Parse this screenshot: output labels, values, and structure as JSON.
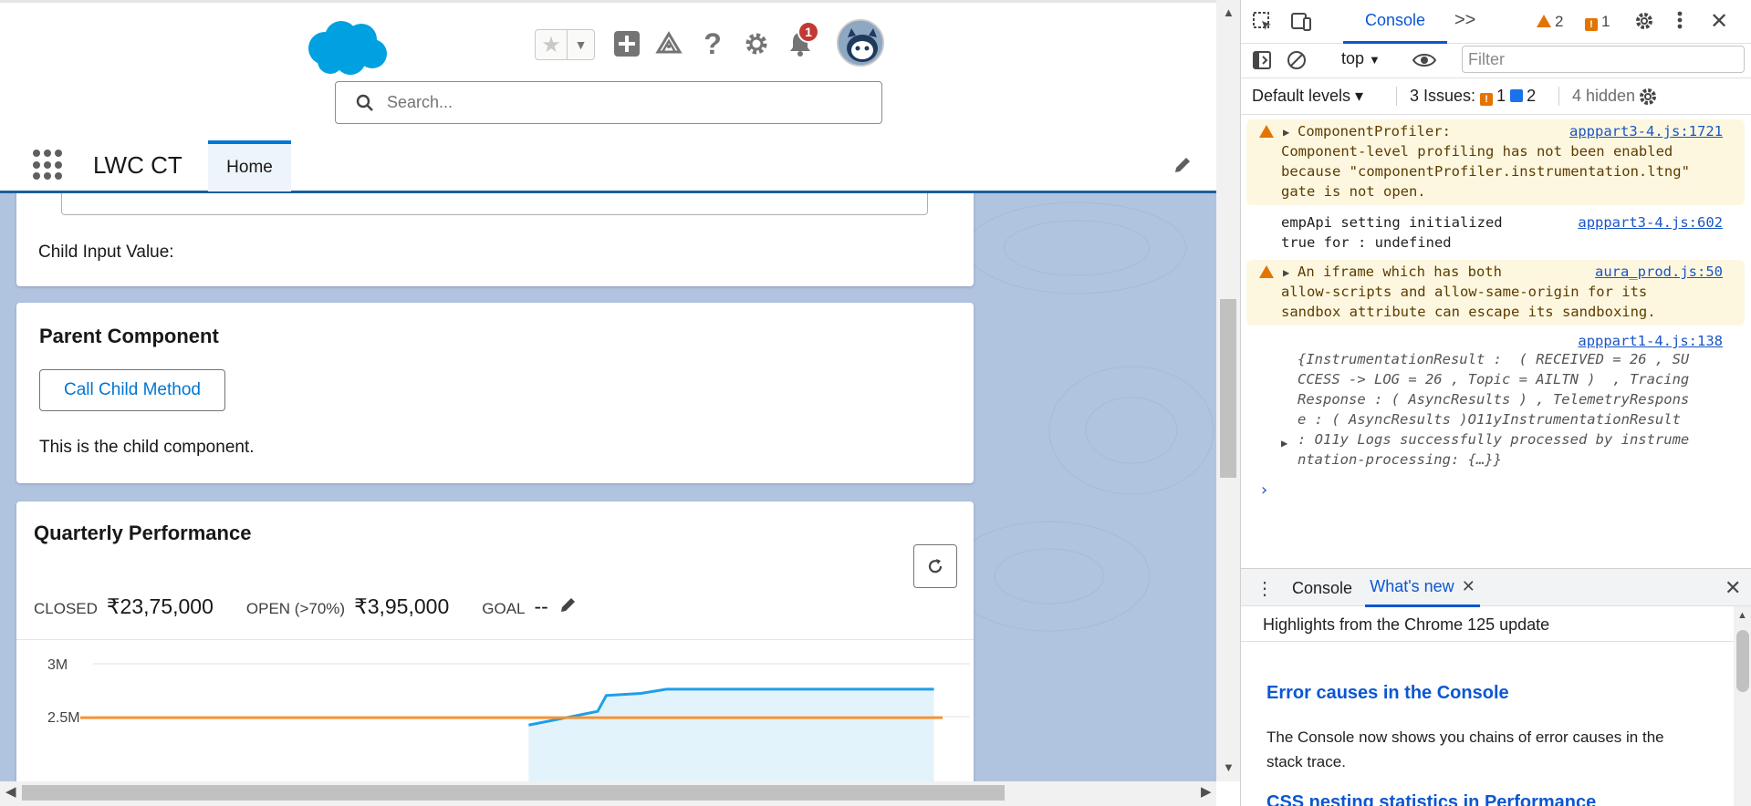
{
  "header": {
    "search_placeholder": "Search...",
    "notification_count": "1",
    "help_glyph": "?"
  },
  "nav": {
    "app_name": "LWC CT",
    "tab_home": "Home"
  },
  "card_child_input": {
    "label": "Child Input Value:"
  },
  "card_parent": {
    "title": "Parent Component",
    "button_label": "Call Child Method",
    "child_text": "This is the child component."
  },
  "card_performance": {
    "title": "Quarterly Performance",
    "closed_label": "CLOSED",
    "closed_value": "₹23,75,000",
    "open_label": "OPEN (>70%)",
    "open_value": "₹3,95,000",
    "goal_label": "GOAL",
    "goal_value": "--"
  },
  "chart_data": {
    "type": "line",
    "title": "",
    "yticks": [
      "3M",
      "2.5M"
    ],
    "ylim": [
      2.45,
      3.0
    ],
    "series": [
      {
        "color": "#1e9fe8",
        "fill": "#e3f3fb",
        "x": [
          0.52,
          0.6,
          0.61,
          0.65,
          0.68,
          0.99
        ],
        "y": [
          2.42,
          2.55,
          2.7,
          2.72,
          2.76,
          2.76
        ]
      },
      {
        "color": "#f59331",
        "x": [
          0,
          1
        ],
        "y": [
          2.49,
          2.49
        ]
      }
    ]
  },
  "devtools": {
    "tab_console": "Console",
    "more_tabs": ">>",
    "warn_count": "2",
    "error_count": "1",
    "context": "top",
    "filter_placeholder": "Filter",
    "default_levels": "Default levels ▾",
    "issues_label": "3 Issues:",
    "issues_error": "1",
    "issues_info": "2",
    "hidden": "4 hidden",
    "messages": [
      {
        "source": "apppart3-4.js:1721",
        "text": "ComponentProfiler:\nComponent-level profiling has not been enabled\nbecause \"componentProfiler.instrumentation.ltng\"\ngate is not open."
      },
      {
        "source": "apppart3-4.js:602",
        "text": "empApi setting initialized\ntrue for : undefined"
      },
      {
        "source": "aura_prod.js:50",
        "text": "An iframe which has both\nallow-scripts and allow-same-origin for its\nsandbox attribute can escape its sandboxing."
      },
      {
        "source": "apppart1-4.js:138",
        "text": "{InstrumentationResult :  ( RECEIVED = 26 , SU\nCCESS -> LOG = 26 , Topic = AILTN )  , Tracing\nResponse : ( AsyncResults ) , TelemetryRespons\ne : ( AsyncResults )O11yInstrumentationResult\n: O11y Logs successfully processed by instrume\nntation-processing: {…}}"
      }
    ],
    "drawer": {
      "console_tab": "Console",
      "whatsnew_tab": "What's new",
      "highlights": "Highlights from the Chrome 125 update",
      "heading1": "Error causes in the Console",
      "para1": "The Console now shows you chains of error causes in the stack trace.",
      "heading2": "CSS nesting statistics in Performance"
    }
  }
}
